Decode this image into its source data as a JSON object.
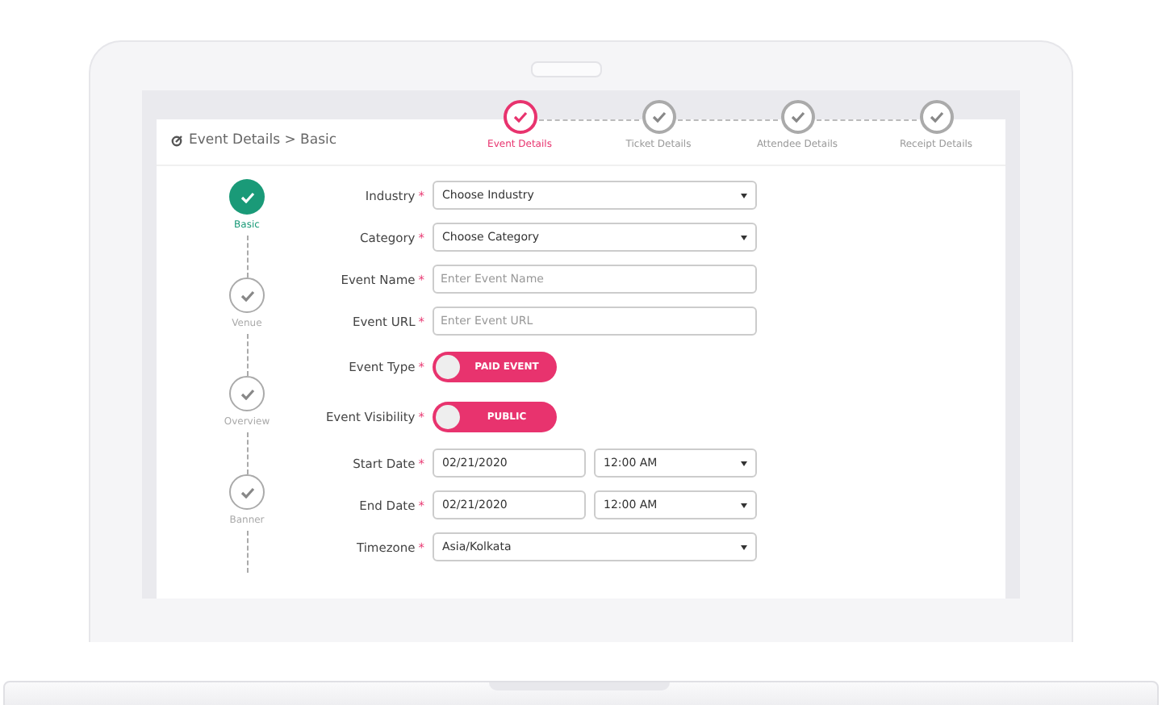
{
  "header": {
    "breadcrumb": "Event Details > Basic"
  },
  "top_steps": [
    {
      "label": "Event Details",
      "selected": true
    },
    {
      "label": "Ticket Details",
      "selected": false
    },
    {
      "label": "Attendee Details",
      "selected": false
    },
    {
      "label": "Receipt Details",
      "selected": false
    }
  ],
  "side_steps": [
    {
      "label": "Basic",
      "selected": true
    },
    {
      "label": "Venue",
      "selected": false
    },
    {
      "label": "Overview",
      "selected": false
    },
    {
      "label": "Banner",
      "selected": false
    }
  ],
  "form": {
    "fields": [
      {
        "kind": "select",
        "label": "Industry",
        "required_mark": "*",
        "value": "Choose Industry"
      },
      {
        "kind": "select",
        "label": "Category",
        "required_mark": "*",
        "value": "Choose Category"
      },
      {
        "kind": "input",
        "label": "Event Name",
        "required_mark": "*",
        "placeholder": "Enter Event Name"
      },
      {
        "kind": "input",
        "label": "Event URL",
        "required_mark": "*",
        "placeholder": "Enter Event URL"
      },
      {
        "kind": "toggle",
        "label": "Event Type",
        "required_mark": "*",
        "value": "PAID EVENT",
        "on": false
      },
      {
        "kind": "toggle",
        "label": "Event Visibility",
        "required_mark": "*",
        "value": "PUBLIC",
        "on": false
      },
      {
        "kind": "datetime",
        "label": "Start Date",
        "required_mark": "*",
        "date": "02/21/2020",
        "time": "12:00 AM"
      },
      {
        "kind": "datetime",
        "label": "End Date",
        "required_mark": "*",
        "date": "02/21/2020",
        "time": "12:00 AM"
      },
      {
        "kind": "select",
        "label": "Timezone",
        "required_mark": "*",
        "value": "Asia/Kolkata"
      }
    ]
  }
}
